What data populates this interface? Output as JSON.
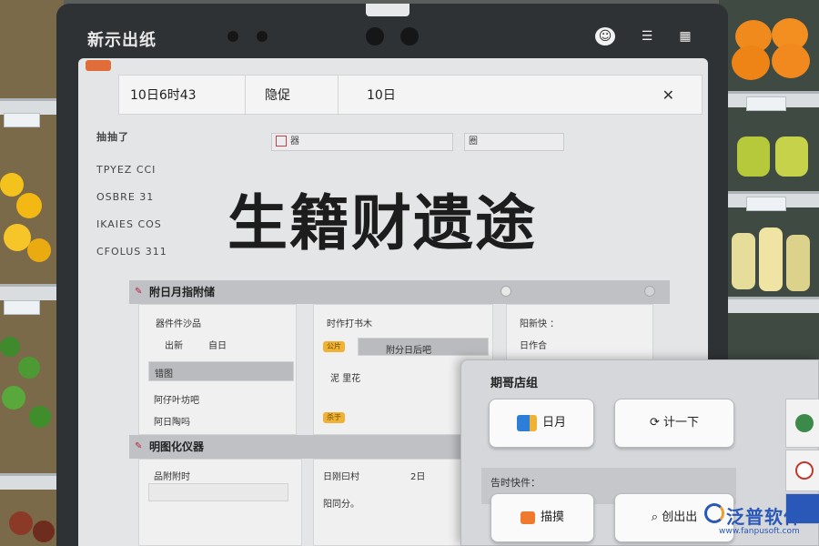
{
  "window": {
    "brand_label": "新示出纸"
  },
  "dialog": {
    "cell1": "10日6时43",
    "cell2": "隐促",
    "cell3": "10日",
    "close_glyph": "✕"
  },
  "sidebar": {
    "heading": "抽抽了",
    "items": [
      "TPYEZ CCI",
      "OSBRE 31",
      "IKAIES COS",
      "CFOLUS 311"
    ]
  },
  "filters": {
    "field1": "器",
    "field2": "圈"
  },
  "headline": "生籍财遗途",
  "panel_a": {
    "title": "附日月指附储",
    "col1_label": "器件件沙品",
    "col1_row1": "出新",
    "col1_row1_value": "自日",
    "col1_highlight": "错图",
    "col1_row3": "阿仔叶坊吧",
    "col1_row4": "阿日陶吗",
    "col2_label": "时作打书木",
    "col2_tag": "公片",
    "col2_field": "附分日后吧",
    "col2_row2": "泥 里花",
    "col2_tag2": "杀于",
    "col3_label": "阳新快 ：",
    "col3_row1": "日作合"
  },
  "panel_b": {
    "title": "明图化仪器",
    "row1": "品附附时",
    "col2_label": "日刚曰村",
    "col2_value": "2日",
    "col2_row2": "阳同分。"
  },
  "action_panel": {
    "title": "期哥店组",
    "btn_a": "日月",
    "btn_b": "计一下",
    "section_label": "告时快件：",
    "btn_c": "描摸",
    "btn_d": "创出出"
  },
  "watermark": {
    "name": "泛普软件",
    "url": "www.fanpusoft.com"
  },
  "colors": {
    "accent_orange": "#e06c3a",
    "tag_yellow": "#f0b234",
    "watermark_blue": "#2a58b8"
  },
  "icons": [
    "camera-icon",
    "close-icon",
    "refresh-icon",
    "search-icon",
    "leaf-icon",
    "fire-icon"
  ]
}
